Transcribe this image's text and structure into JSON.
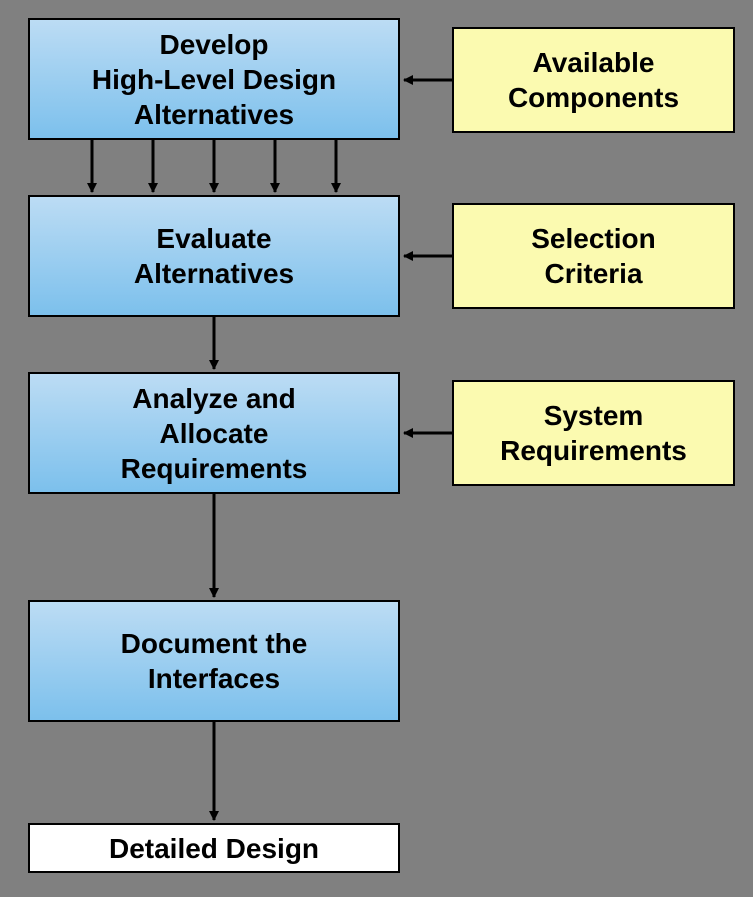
{
  "nodes": {
    "develop": "Develop\nHigh-Level Design\nAlternatives",
    "available": "Available\nComponents",
    "evaluate": "Evaluate\nAlternatives",
    "selection": "Selection\nCriteria",
    "analyze": "Analyze and\nAllocate\nRequirements",
    "system": "System\nRequirements",
    "document": "Document the\nInterfaces",
    "detailed": "Detailed Design"
  },
  "colors": {
    "process": "#7cc0ec",
    "input": "#fbfab0",
    "output": "#ffffff",
    "background": "#808080",
    "border": "#000000"
  },
  "edges": [
    {
      "from": "available",
      "to": "develop"
    },
    {
      "from": "develop",
      "to": "evaluate",
      "multiplicity": 5
    },
    {
      "from": "selection",
      "to": "evaluate"
    },
    {
      "from": "evaluate",
      "to": "analyze"
    },
    {
      "from": "system",
      "to": "analyze"
    },
    {
      "from": "analyze",
      "to": "document"
    },
    {
      "from": "document",
      "to": "detailed"
    }
  ]
}
